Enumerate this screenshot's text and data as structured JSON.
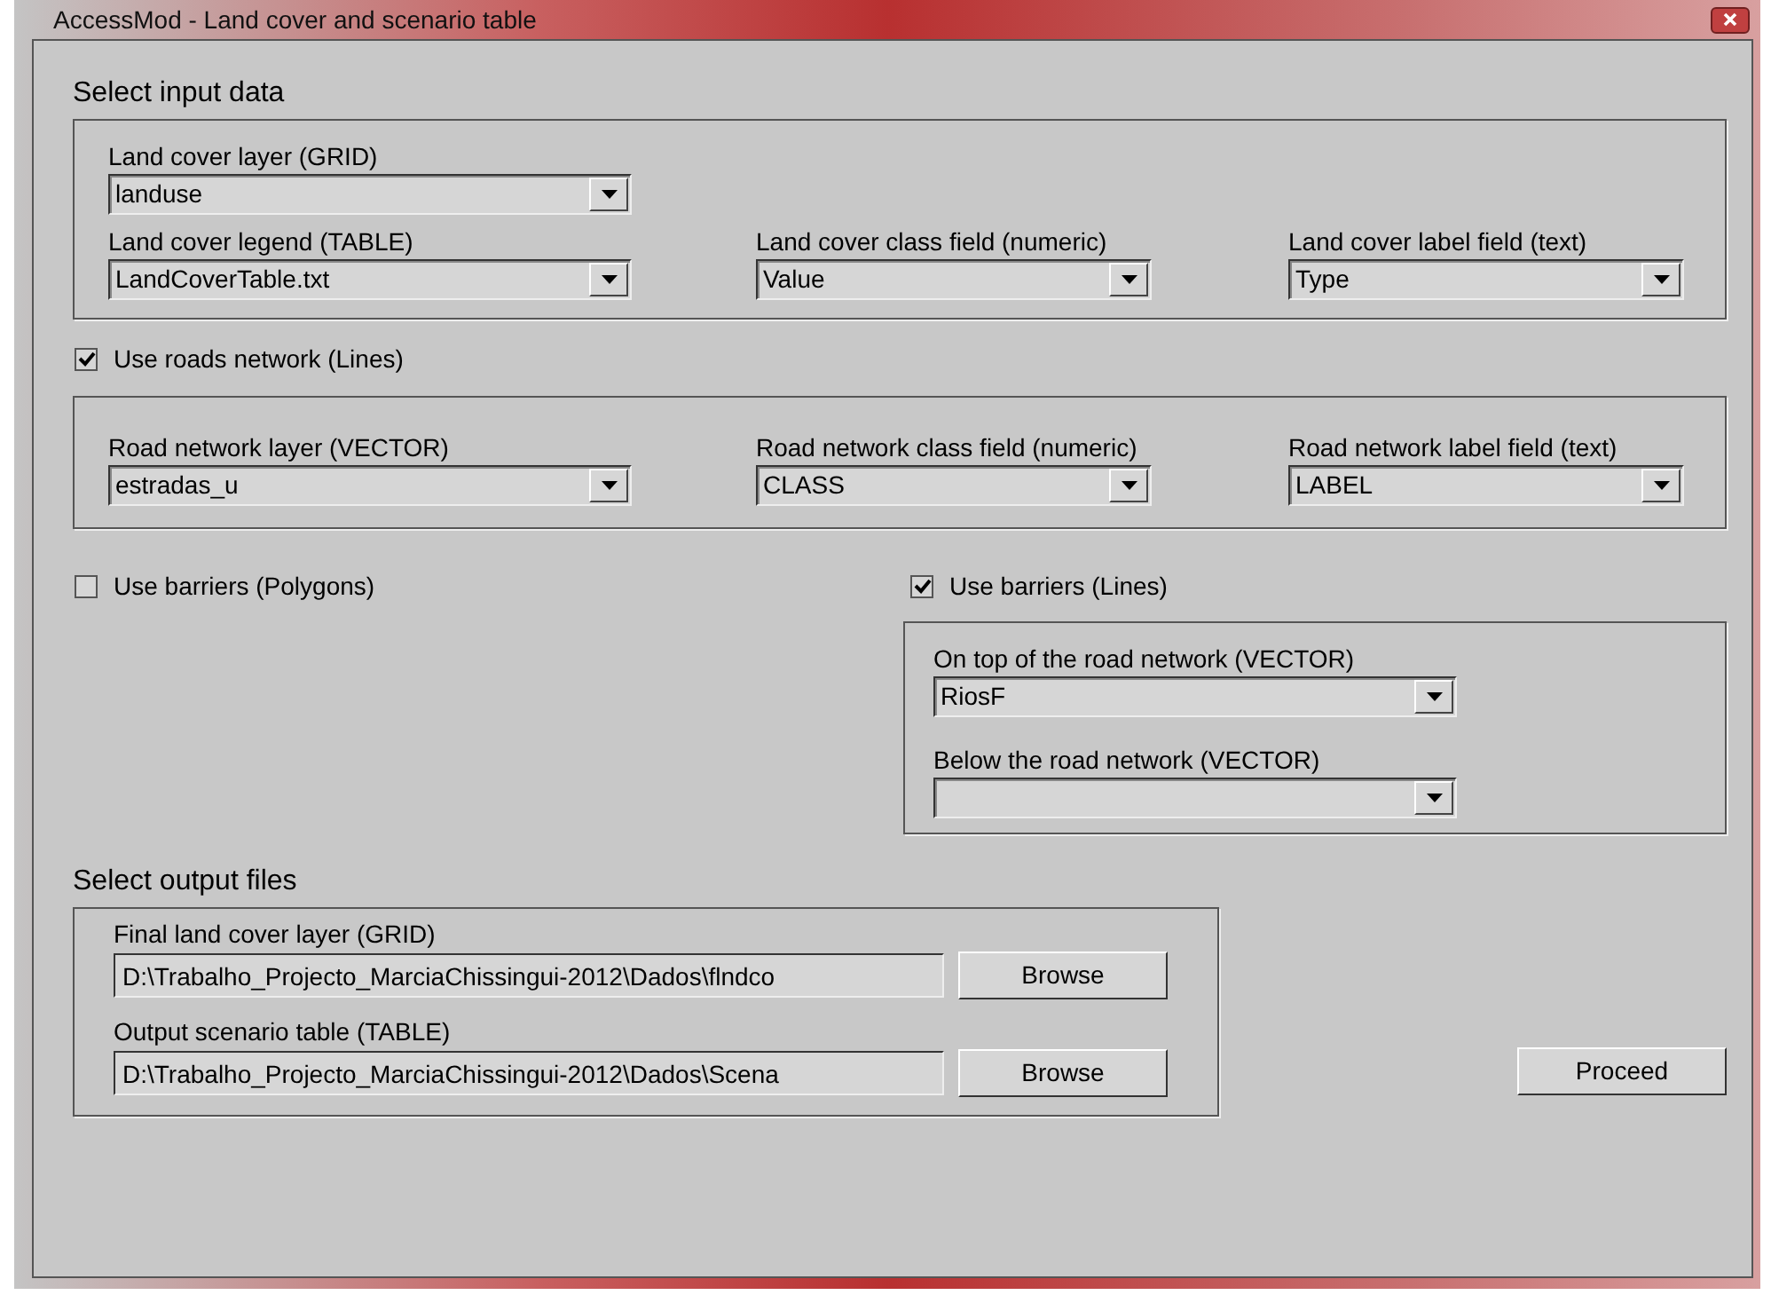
{
  "window": {
    "title": "AccessMod - Land cover and scenario table"
  },
  "input_data": {
    "heading": "Select input data",
    "rows": [
      [
        {
          "label": "Land cover layer (GRID)",
          "value": "landuse"
        }
      ],
      [
        {
          "label": "Land cover legend (TABLE)",
          "value": "LandCoverTable.txt"
        },
        {
          "label": "Land cover class field (numeric)",
          "value": "Value"
        },
        {
          "label": "Land cover label field (text)",
          "value": "Type"
        }
      ]
    ]
  },
  "roads": {
    "label": "Use roads network (Lines)",
    "checked": true,
    "combos": [
      {
        "label": "Road network layer (VECTOR)",
        "value": "estradas_u"
      },
      {
        "label": "Road network class field (numeric)",
        "value": "CLASS"
      },
      {
        "label": "Road network label field (text)",
        "value": "LABEL"
      }
    ]
  },
  "barriers_polygons": {
    "label": "Use barriers (Polygons)",
    "checked": false
  },
  "barriers_lines": {
    "label": "Use barriers (Lines)",
    "checked": true,
    "combos": [
      {
        "label": "On top of the road network (VECTOR)",
        "value": "RiosF"
      },
      {
        "label": "Below the road network (VECTOR)"
      }
    ]
  },
  "output_files": {
    "heading": "Select output files",
    "fields": [
      {
        "label": "Final land cover layer (GRID)",
        "value": "D:\\Trabalho_Projecto_MarciaChissingui-2012\\Dados\\flndco",
        "button": "Browse"
      },
      {
        "label": "Output scenario table (TABLE)",
        "value": "D:\\Trabalho_Projecto_MarciaChissingui-2012\\Dados\\Scena",
        "button": "Browse"
      }
    ]
  },
  "proceed_button": "Proceed"
}
